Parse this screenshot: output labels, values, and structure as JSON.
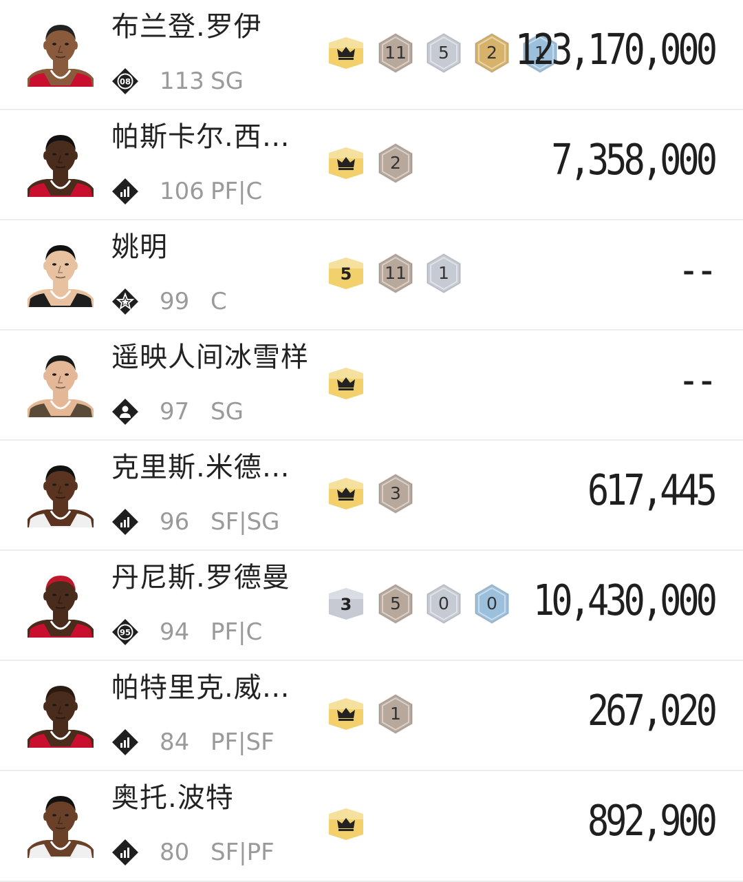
{
  "players": [
    {
      "name": "布兰登.罗伊",
      "rank_icon": "number-badge",
      "rank_text": "08",
      "ovr": "113",
      "pos": "SG",
      "avatar": "player-1",
      "jersey": "#c8102e",
      "skin": "#8a5a3c",
      "hair": "#222222",
      "badges": [
        {
          "type": "crown",
          "text": ""
        },
        {
          "type": "bronze",
          "text": "11"
        },
        {
          "type": "silver",
          "text": "5"
        },
        {
          "type": "gold",
          "text": "2"
        },
        {
          "type": "blue",
          "text": "1"
        }
      ],
      "price": "123,170,000"
    },
    {
      "name": "帕斯卡尔.西…",
      "rank_icon": "bars-icon",
      "rank_text": "",
      "ovr": "106",
      "pos": "PF|C",
      "avatar": "player-2",
      "jersey": "#c8102e",
      "skin": "#4a2c1c",
      "hair": "#111111",
      "badges": [
        {
          "type": "crown",
          "text": ""
        },
        {
          "type": "bronze",
          "text": "2"
        }
      ],
      "price": "7,358,000"
    },
    {
      "name": "姚明",
      "rank_icon": "star-icon",
      "rank_text": "",
      "ovr": "99",
      "pos": "C",
      "avatar": "player-3",
      "jersey": "#1e1e1e",
      "skin": "#e8c2a0",
      "hair": "#111111",
      "badges": [
        {
          "type": "gold-plain",
          "text": "5"
        },
        {
          "type": "bronze",
          "text": "11"
        },
        {
          "type": "silver",
          "text": "1"
        }
      ],
      "price": "--"
    },
    {
      "name": "遥映人间冰雪样",
      "rank_icon": "person-icon",
      "rank_text": "",
      "ovr": "97",
      "pos": "SG",
      "avatar": "player-4",
      "jersey": "#5a4a3a",
      "skin": "#e4b896",
      "hair": "#1a1a1a",
      "badges": [
        {
          "type": "crown",
          "text": ""
        }
      ],
      "price": "--"
    },
    {
      "name": "克里斯.米德…",
      "rank_icon": "bars-icon",
      "rank_text": "",
      "ovr": "96",
      "pos": "SF|SG",
      "avatar": "player-5",
      "jersey": "#f0f0f0",
      "skin": "#5a3420",
      "hair": "#111111",
      "badges": [
        {
          "type": "crown",
          "text": ""
        },
        {
          "type": "bronze",
          "text": "3"
        }
      ],
      "price": "617,445"
    },
    {
      "name": "丹尼斯.罗德曼",
      "rank_icon": "number-badge",
      "rank_text": "95",
      "ovr": "94",
      "pos": "PF|C",
      "avatar": "player-6",
      "jersey": "#c8102e",
      "skin": "#4a2c1c",
      "hair": "#c0182a",
      "badges": [
        {
          "type": "silver-plain",
          "text": "3"
        },
        {
          "type": "bronze",
          "text": "5"
        },
        {
          "type": "silver",
          "text": "0"
        },
        {
          "type": "blue",
          "text": "0"
        }
      ],
      "price": "10,430,000"
    },
    {
      "name": "帕特里克.威…",
      "rank_icon": "bars-icon",
      "rank_text": "",
      "ovr": "84",
      "pos": "PF|SF",
      "avatar": "player-7",
      "jersey": "#c8102e",
      "skin": "#4a2c1c",
      "hair": "#2a1a10",
      "badges": [
        {
          "type": "crown",
          "text": ""
        },
        {
          "type": "bronze",
          "text": "1"
        }
      ],
      "price": "267,020"
    },
    {
      "name": "奥托.波特",
      "rank_icon": "bars-icon",
      "rank_text": "",
      "ovr": "80",
      "pos": "SF|PF",
      "avatar": "player-8",
      "jersey": "#f0f0f0",
      "skin": "#6a4028",
      "hair": "#111111",
      "badges": [
        {
          "type": "crown",
          "text": ""
        }
      ],
      "price": "892,900"
    }
  ],
  "colors": {
    "crown_bg": "#f2d06b",
    "bronze": "#b8a89c",
    "silver": "#c5cad3",
    "gold": "#d6b26a",
    "blue": "#9cc0dc"
  }
}
